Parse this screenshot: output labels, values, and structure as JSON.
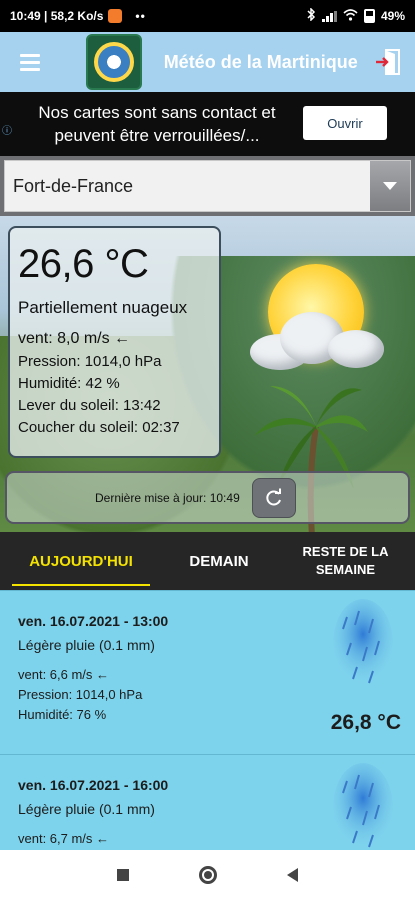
{
  "statusbar": {
    "time_speed": "10:49 | 58,2 Ko/s",
    "dots": "••",
    "battery": "49%"
  },
  "appbar": {
    "title": "Météo de la Martinique",
    "menu_icon": "hamburger-menu-icon",
    "exit_icon": "exit-door-icon"
  },
  "ad": {
    "text": "Nos cartes sont sans contact et peuvent être verrouillées/...",
    "button": "Ouvrir",
    "info_icon": "ad-info-icon"
  },
  "city": {
    "selected": "Fort-de-France"
  },
  "current": {
    "temperature": "26,6 °C",
    "condition": "Partiellement nuageux",
    "wind": "vent: 8,0 m/s ←",
    "pressure": "Pression: 1014,0 hPa",
    "humidity": "Humidité: 42 %",
    "sunrise": "Lever du soleil: 13:42",
    "sunset": "Coucher du soleil: 02:37",
    "last_update": "Dernière mise à jour: 10:49"
  },
  "tabs": {
    "today": "AUJOURD'HUI",
    "tomorrow": "DEMAIN",
    "rest_of_week": "RESTE DE LA SEMAINE"
  },
  "forecast": [
    {
      "datetime": "ven. 16.07.2021 - 13:00",
      "description": "Légère pluie (0.1 mm)",
      "wind": "vent: 6,6 m/s ←",
      "pressure": "Pression: 1014,0 hPa",
      "humidity": "Humidité: 76 %",
      "temperature": "26,8 °C"
    },
    {
      "datetime": "ven. 16.07.2021 - 16:00",
      "description": "Légère pluie (0.1 mm)",
      "wind": "vent: 6,7 m/s ←"
    }
  ],
  "colors": {
    "appbar": "#a6d2ef",
    "tab_active": "#f4e200",
    "tabs_bg": "#262626",
    "list_bg": "#7ed3ec"
  }
}
